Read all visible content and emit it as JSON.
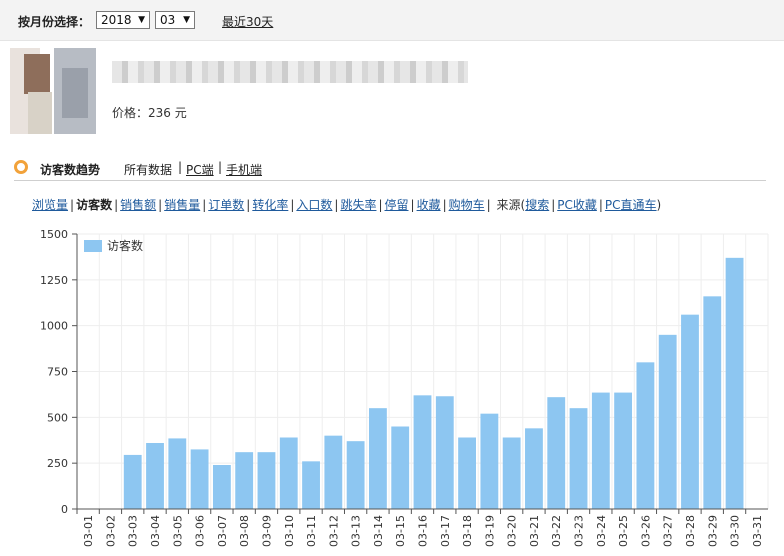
{
  "filter": {
    "label": "按月份选择：",
    "year": "2018",
    "month": "03",
    "recent_link": "最近30天"
  },
  "product": {
    "price_text": "价格：236 元"
  },
  "trend": {
    "title": "访客数趋势",
    "links": [
      "所有数据",
      "PC端",
      "手机端"
    ]
  },
  "metrics": {
    "items": [
      "浏览量",
      "访客数",
      "销售额",
      "销售量",
      "订单数",
      "转化率",
      "入口数",
      "跳失率",
      "停留",
      "收藏",
      "购物车"
    ],
    "active_index": 1,
    "source_label": "来源(",
    "source_items": [
      "搜索",
      "PC收藏",
      "PC直通车"
    ],
    "source_close": ")"
  },
  "chart_data": {
    "type": "bar",
    "legend": "访客数",
    "legend_position": "top-left",
    "grid": true,
    "ylim": [
      0,
      1500
    ],
    "yticks": [
      0,
      250,
      500,
      750,
      1000,
      1250,
      1500
    ],
    "categories": [
      "03-01",
      "03-02",
      "03-03",
      "03-04",
      "03-05",
      "03-06",
      "03-07",
      "03-08",
      "03-09",
      "03-10",
      "03-11",
      "03-12",
      "03-13",
      "03-14",
      "03-15",
      "03-16",
      "03-17",
      "03-18",
      "03-19",
      "03-20",
      "03-21",
      "03-22",
      "03-23",
      "03-24",
      "03-25",
      "03-26",
      "03-27",
      "03-28",
      "03-29",
      "03-30",
      "03-31"
    ],
    "values": [
      0,
      0,
      295,
      360,
      385,
      325,
      240,
      310,
      310,
      390,
      260,
      400,
      370,
      550,
      450,
      620,
      615,
      390,
      520,
      390,
      440,
      610,
      550,
      635,
      635,
      800,
      950,
      1060,
      1160,
      1370
    ],
    "colors": {
      "bar": "#8dc6f1",
      "grid": "#eeeeee",
      "axis": "#555555"
    }
  }
}
